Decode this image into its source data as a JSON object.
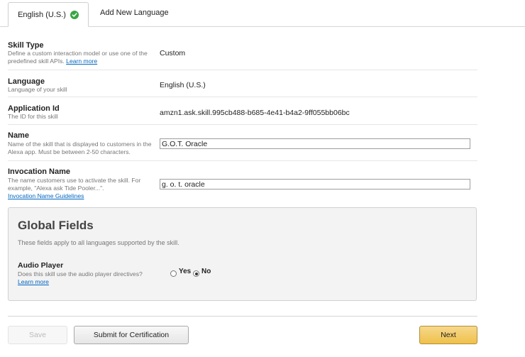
{
  "tabs": {
    "active_label": "English (U.S.)",
    "add_label": "Add New Language"
  },
  "skill_type": {
    "label": "Skill Type",
    "desc": "Define a custom interaction model or use one of the predefined skill APIs.",
    "link": "Learn more",
    "value": "Custom"
  },
  "language": {
    "label": "Language",
    "desc": "Language of your skill",
    "value": "English (U.S.)"
  },
  "application_id": {
    "label": "Application Id",
    "desc": "The ID for this skill",
    "value": "amzn1.ask.skill.995cb488-b685-4e41-b4a2-9ff055bb06bc"
  },
  "name": {
    "label": "Name",
    "desc": "Name of the skill that is displayed to customers in the Alexa app. Must be between 2-50 characters.",
    "value": "G.O.T. Oracle"
  },
  "invocation": {
    "label": "Invocation Name",
    "desc": "The name customers use to activate the skill. For example, \"Alexa ask Tide Pooler...\".",
    "link": "Invocation Name Guidelines",
    "value": "g. o. t. oracle"
  },
  "global": {
    "title": "Global Fields",
    "desc": "These fields apply to all languages supported by the skill.",
    "audio_label": "Audio Player",
    "audio_desc": "Does this skill use the audio player directives?",
    "audio_link": "Learn more",
    "yes_label": "Yes",
    "no_label": "No",
    "selected": "No"
  },
  "footer": {
    "save": "Save",
    "submit": "Submit for Certification",
    "next": "Next"
  },
  "colors": {
    "link": "#0066c0",
    "check": "#3aa545",
    "next_button": "#efc04a"
  }
}
